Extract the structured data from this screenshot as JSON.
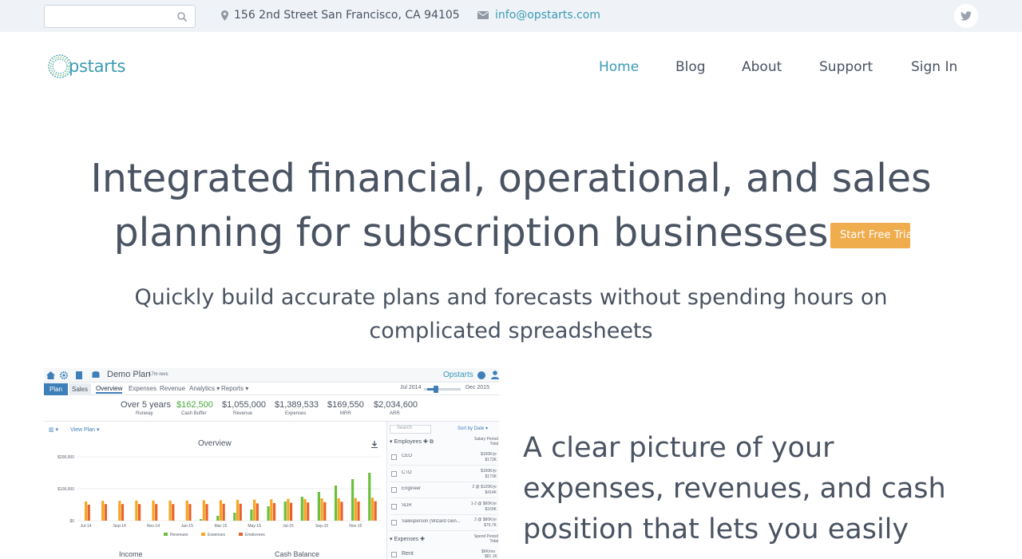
{
  "topbar": {
    "search_placeholder": "",
    "address": "156 2nd Street San Francisco, CA 94105",
    "email": "info@opstarts.com"
  },
  "header": {
    "logo_text": "pstarts",
    "nav": [
      "Home",
      "Blog",
      "About",
      "Support",
      "Sign In"
    ],
    "active_nav": "Home"
  },
  "hero": {
    "headline_line1": "Integrated financial, operational, and sales",
    "headline_line2": "planning for subscription businesses",
    "cta": "Start Free Trial",
    "subheadline": "Quickly build accurate plans and forecasts without spending hours on complicated spreadsheets"
  },
  "app_screenshot": {
    "plan_title": "Demo Plan",
    "plan_subtitle": "17m revs",
    "menus": [
      "Analytics ▾",
      "Reports ▾"
    ],
    "brand": "Opstarts",
    "mode_tabs": [
      "Plan",
      "Sales"
    ],
    "tabs": [
      "Overview",
      "Expenses",
      "Revenue",
      "Analytics ▾",
      "Reports ▾"
    ],
    "range_start": "Jul 2014",
    "range_end": "Dec 2015",
    "period": "Over 5 years",
    "period_sub": "Runway",
    "kpis": [
      {
        "value": "$162,500",
        "label": "Cash Buffer"
      },
      {
        "value": "$1,055,000",
        "label": "Revenue"
      },
      {
        "value": "$1,389,533",
        "label": "Expenses"
      },
      {
        "value": "$169,550",
        "label": "MRR"
      },
      {
        "value": "$2,034,600",
        "label": "ARR"
      }
    ],
    "view_plan": "View Plan ▾",
    "chart_title": "Overview",
    "search_label": "Search",
    "sort_label": "Sort by Date ▾",
    "employees_header": "Employees",
    "salary_header": "Salary Period Total",
    "employees": [
      {
        "name": "CEO",
        "value": "$100K/yr",
        "sub": "$173K"
      },
      {
        "name": "CTO",
        "value": "$100K/yr",
        "sub": "$173K"
      },
      {
        "name": "Engineer",
        "value": "2 @ $120K/yr",
        "sub": "$414K"
      },
      {
        "name": "SDR",
        "value": "1-2 @ $60K/yr",
        "sub": "$169K"
      },
      {
        "name": "Salesperson (Wizard Gen...",
        "value": "2 @ $80K/yr",
        "sub": "$76.7K"
      }
    ],
    "expenses_header": "Expenses",
    "spend_header": "Spend Period Total",
    "expenses": [
      {
        "name": "Rent",
        "value": "$6K/mo",
        "sub": "$81.1K"
      }
    ],
    "bottom_labels": [
      "Income",
      "Cash Balance"
    ],
    "chart_data": {
      "type": "bar",
      "title": "Overview",
      "ylim": [
        0,
        200000
      ],
      "y_ticks": [
        "$200,000",
        "$100,000",
        "$0"
      ],
      "x_tick_labels": [
        "Jul-14",
        "Sep-14",
        "Nov-14",
        "Jan-15",
        "Mar-15",
        "May-15",
        "Jul-15",
        "Sep-15",
        "Nov-15"
      ],
      "categories": [
        "Jul-14",
        "Aug-14",
        "Sep-14",
        "Oct-14",
        "Nov-14",
        "Dec-14",
        "Jan-15",
        "Feb-15",
        "Mar-15",
        "Apr-15",
        "May-15",
        "Jun-15",
        "Jul-15",
        "Aug-15",
        "Sep-15",
        "Oct-15",
        "Nov-15",
        "Dec-15"
      ],
      "series": [
        {
          "name": "Revenues",
          "color": "#6cbf3f",
          "values": [
            0,
            0,
            0,
            0,
            0,
            0,
            0,
            5000,
            15000,
            25000,
            35000,
            45000,
            60000,
            75000,
            90000,
            110000,
            130000,
            150000
          ]
        },
        {
          "name": "Expenses",
          "color": "#f5a623",
          "values": [
            60000,
            62000,
            62000,
            63000,
            63000,
            63000,
            63000,
            64000,
            64000,
            65000,
            66000,
            67000,
            68000,
            68000,
            70000,
            70000,
            71000,
            72000
          ]
        },
        {
          "name": "Employees",
          "color": "#e8632a",
          "values": [
            50000,
            52000,
            52000,
            52000,
            52000,
            52000,
            52000,
            52000,
            53000,
            53000,
            54000,
            55000,
            56000,
            57000,
            58000,
            59000,
            60000,
            61000
          ]
        }
      ]
    }
  },
  "side": {
    "line1": "A clear picture of your",
    "line2": "expenses, revenues, and cash",
    "line3": "position that lets you easily"
  },
  "colors": {
    "accent": "#3a9bb2",
    "cta": "#f0ad4e",
    "text": "#4a5362",
    "topbar": "#eff3f7"
  }
}
